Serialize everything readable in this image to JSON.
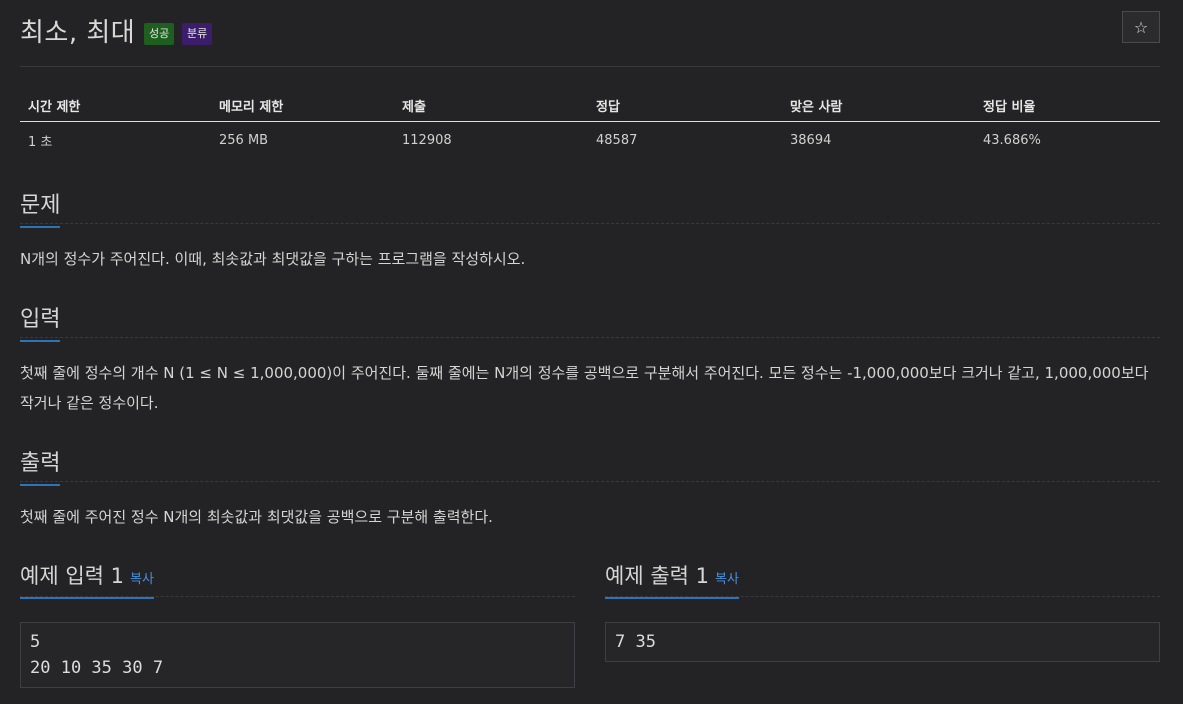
{
  "problem": {
    "title": "최소, 최대",
    "badges": {
      "success": "성공",
      "category": "분류"
    },
    "star": "☆"
  },
  "info_table": {
    "headers": [
      "시간 제한",
      "메모리 제한",
      "제출",
      "정답",
      "맞은 사람",
      "정답 비율"
    ],
    "values": [
      "1 초",
      "256 MB",
      "112908",
      "48587",
      "38694",
      "43.686%"
    ]
  },
  "sections": {
    "problem": {
      "heading": "문제",
      "body": "N개의 정수가 주어진다. 이때, 최솟값과 최댓값을 구하는 프로그램을 작성하시오."
    },
    "input": {
      "heading": "입력",
      "body": "첫째 줄에 정수의 개수 N (1 ≤ N ≤ 1,000,000)이 주어진다. 둘째 줄에는 N개의 정수를 공백으로 구분해서 주어진다. 모든 정수는 -1,000,000보다 크거나 같고, 1,000,000보다 작거나 같은 정수이다."
    },
    "output": {
      "heading": "출력",
      "body": "첫째 줄에 주어진 정수 N개의 최솟값과 최댓값을 공백으로 구분해 출력한다."
    }
  },
  "samples": {
    "input": {
      "heading": "예제 입력 1",
      "copy": "복사",
      "content": "5\n20 10 35 30 7"
    },
    "output": {
      "heading": "예제 출력 1",
      "copy": "복사",
      "content": "7 35"
    }
  }
}
